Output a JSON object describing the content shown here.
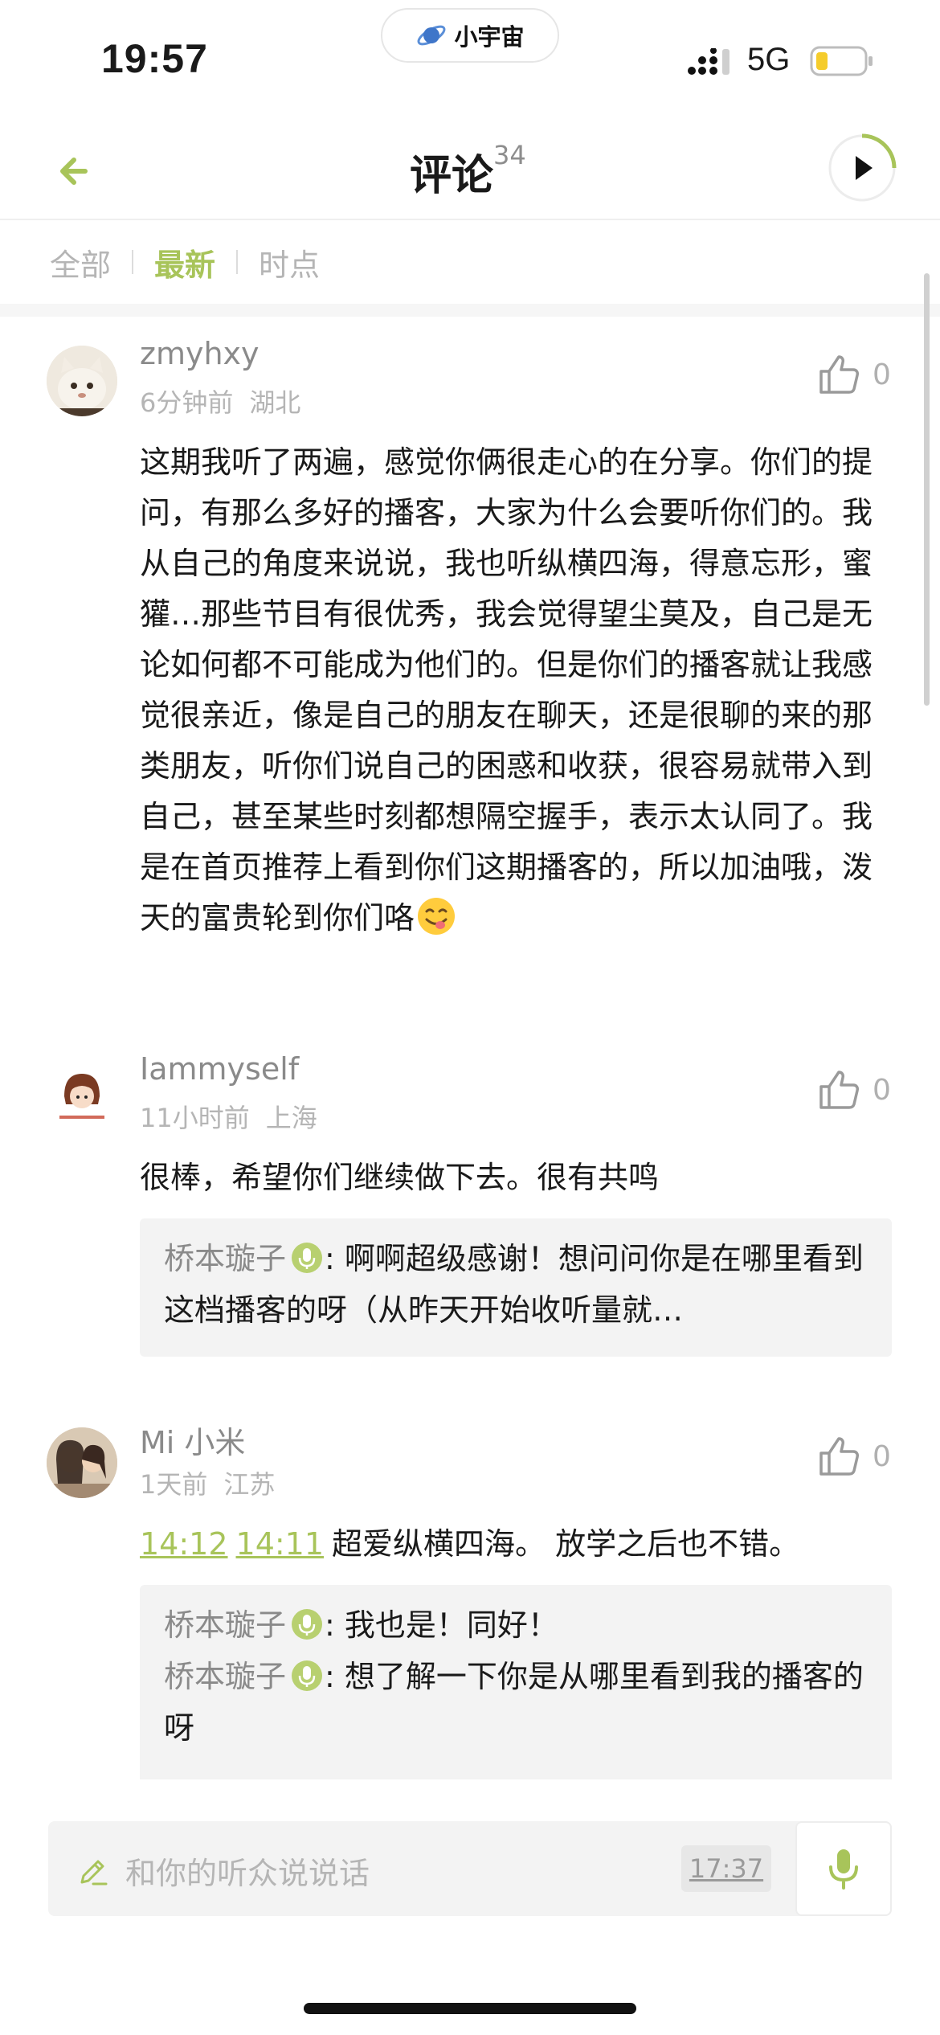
{
  "status_bar": {
    "time": "19:57",
    "app_pill_label": "小宇宙",
    "network": "5G"
  },
  "header": {
    "title": "评论",
    "count": "34"
  },
  "tabs": [
    {
      "label": "全部",
      "active": false
    },
    {
      "label": "最新",
      "active": true
    },
    {
      "label": "时点",
      "active": false
    }
  ],
  "comments": [
    {
      "user": "zmyhxy",
      "time": "6分钟前",
      "location": "湖北",
      "likes": "0",
      "text": "这期我听了两遍，感觉你俩很走心的在分享。你们的提问，有那么多好的播客，大家为什么会要听你们的。我从自己的角度来说说，我也听纵横四海，得意忘形，蜜獾…那些节目有很优秀，我会觉得望尘莫及，自己是无论如何都不可能成为他们的。但是你们的播客就让我感觉很亲近，像是自己的朋友在聊天，还是很聊的来的那类朋友，听你们说自己的困惑和收获，很容易就带入到自己，甚至某些时刻都想隔空握手，表示太认同了。我是在首页推荐上看到你们这期播客的，所以加油哦，泼天的富贵轮到你们咯",
      "emoji": "smiling-face-with-tongue-icon"
    },
    {
      "user": "Iammyself",
      "time": "11小时前",
      "location": "上海",
      "likes": "0",
      "text": "很棒，希望你们继续做下去。很有共鸣",
      "replies": [
        {
          "user": "桥本璇子",
          "text": ": 啊啊超级感谢！想问问你是在哪里看到这档播客的呀（从昨天开始收听量就…"
        }
      ]
    },
    {
      "user": "Mi 小米",
      "time": "1天前",
      "location": "江苏",
      "likes": "0",
      "timestamps": [
        "14:12",
        "14:11"
      ],
      "text": "超爱纵横四海。 放学之后也不错。",
      "replies": [
        {
          "user": "桥本璇子",
          "text": ": 我也是！同好！"
        },
        {
          "user": "桥本璇子",
          "text": ": 想了解一下你是从哪里看到我的播客的呀"
        }
      ]
    }
  ],
  "input": {
    "placeholder": "和你的听众说说话",
    "time_chip": "17:37"
  },
  "colors": {
    "accent": "#a8c45a",
    "muted": "#b5b5b5",
    "reply_bg": "#f3f3f3"
  }
}
